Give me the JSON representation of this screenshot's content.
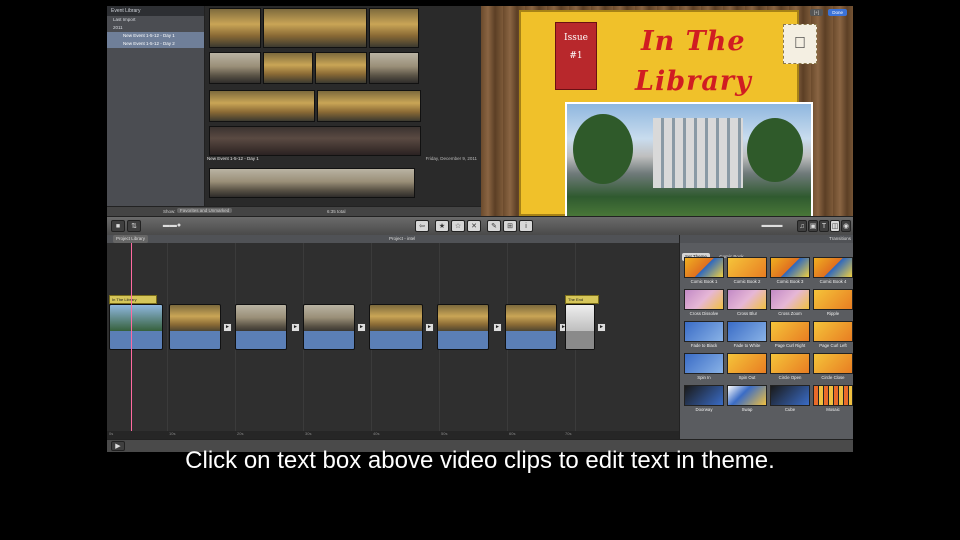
{
  "event_library": {
    "header": "Event Library",
    "items": [
      {
        "label": "Last Import",
        "selected": false,
        "indent": false
      },
      {
        "label": "2011",
        "selected": false,
        "indent": false
      },
      {
        "label": "New Event 1-5-12 - Day 1",
        "selected": true,
        "indent": true
      },
      {
        "label": "New Event 1-5-12 - Day 2",
        "selected": true,
        "indent": true
      }
    ]
  },
  "browser": {
    "event_title": "New Event 1-5-12 - Day 1",
    "event_date": "Friday, December 9, 2011"
  },
  "status_strip": {
    "show_label": "Show:",
    "show_value": "Favorites and Unmarked",
    "total": "6:35 total"
  },
  "viewer": {
    "issue_label": "Issue",
    "issue_number": "#1",
    "title_line1": "In The",
    "title_line2": "Library",
    "done_button": "Done",
    "fullscreen_button": "[+]"
  },
  "project": {
    "library_label": "Project Library",
    "title": "Project - intel",
    "timeline_title_1": "In The Library",
    "timeline_title_2": "The End",
    "ruler_ticks": [
      "0s",
      "10s",
      "20s",
      "30s",
      "40s",
      "50s",
      "60s",
      "70s"
    ]
  },
  "transitions": {
    "header": "Transitions",
    "tabs": [
      "Set Theme",
      "Comic Book"
    ],
    "items": [
      {
        "label": "Comic Book 1",
        "style": "t-comic"
      },
      {
        "label": "Comic Book 2",
        "style": "t-orange"
      },
      {
        "label": "Comic Book 3",
        "style": "t-comic"
      },
      {
        "label": "Comic Book 4",
        "style": "t-comic"
      },
      {
        "label": "Cross Dissolve",
        "style": "t-pink"
      },
      {
        "label": "Cross Blur",
        "style": "t-pink"
      },
      {
        "label": "Cross Zoom",
        "style": "t-pink"
      },
      {
        "label": "Ripple",
        "style": "t-orange"
      },
      {
        "label": "Fade to Black",
        "style": "t-blue"
      },
      {
        "label": "Fade to White",
        "style": "t-blue"
      },
      {
        "label": "Page Curl Right",
        "style": "t-orange"
      },
      {
        "label": "Page Curl Left",
        "style": "t-orange"
      },
      {
        "label": "Spin In",
        "style": "t-blue"
      },
      {
        "label": "Spin Out",
        "style": "t-orange"
      },
      {
        "label": "Circle Open",
        "style": "t-orange"
      },
      {
        "label": "Circle Close",
        "style": "t-orange"
      },
      {
        "label": "Doorway",
        "style": "t-dark"
      },
      {
        "label": "Swap",
        "style": "t-cube"
      },
      {
        "label": "Cube",
        "style": "t-dark"
      },
      {
        "label": "Mosaic",
        "style": "t-mosaic"
      }
    ]
  },
  "caption": "Click on text box above video clips to edit text in theme."
}
